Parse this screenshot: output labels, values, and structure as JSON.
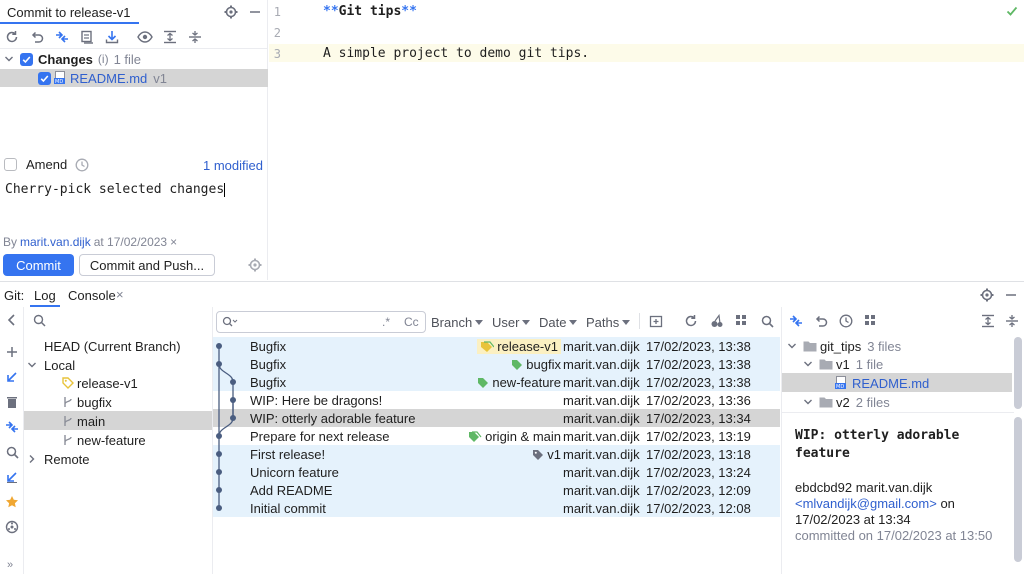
{
  "commit_panel": {
    "tab_title": "Commit to release-v1",
    "changes_label": "Changes",
    "changes_hint": "(i)",
    "changes_count": "1 file",
    "file_name": "README.md",
    "file_version": "v1",
    "amend_label": "Amend",
    "modified_link": "1 modified",
    "message": "Cherry-pick selected changes",
    "author_prefix": "By",
    "author_name": "marit.van.dijk",
    "author_date": "at 17/02/2023",
    "commit_button": "Commit",
    "commit_push_button": "Commit and Push..."
  },
  "editor": {
    "lines": [
      {
        "num": "1",
        "pre": "**",
        "text": "Git tips",
        "post": "**"
      },
      {
        "num": "2",
        "text": ""
      },
      {
        "num": "3",
        "text": "A simple project to demo git tips."
      }
    ]
  },
  "git_panel": {
    "label": "Git:",
    "tabs": [
      {
        "label": "Log"
      },
      {
        "label": "Console"
      }
    ],
    "branches": {
      "head": "HEAD (Current Branch)",
      "local": "Local",
      "local_items": [
        "release-v1",
        "bugfix",
        "main",
        "new-feature"
      ],
      "remote": "Remote"
    },
    "filters": {
      "regex": ".*",
      "case": "Cc",
      "branch": "Branch",
      "user": "User",
      "date": "Date",
      "paths": "Paths"
    },
    "commits": [
      {
        "msg": "Bugfix",
        "tag": "release-v1",
        "author": "marit.van.dijk",
        "date": "17/02/2023, 13:38"
      },
      {
        "msg": "Bugfix",
        "tag": "bugfix",
        "author": "marit.van.dijk",
        "date": "17/02/2023, 13:38"
      },
      {
        "msg": "Bugfix",
        "tag": "new-feature",
        "author": "marit.van.dijk",
        "date": "17/02/2023, 13:38"
      },
      {
        "msg": "WIP: Here be dragons!",
        "tag": "",
        "author": "marit.van.dijk",
        "date": "17/02/2023, 13:36"
      },
      {
        "msg": "WIP: otterly adorable feature",
        "tag": "",
        "author": "marit.van.dijk",
        "date": "17/02/2023, 13:34"
      },
      {
        "msg": "Prepare for next release",
        "tag": "origin & main",
        "author": "marit.van.dijk",
        "date": "17/02/2023, 13:19"
      },
      {
        "msg": "First release!",
        "tag": "v1",
        "author": "marit.van.dijk",
        "date": "17/02/2023, 13:18"
      },
      {
        "msg": "Unicorn feature",
        "tag": "",
        "author": "marit.van.dijk",
        "date": "17/02/2023, 13:24"
      },
      {
        "msg": "Add README",
        "tag": "",
        "author": "marit.van.dijk",
        "date": "17/02/2023, 12:09"
      },
      {
        "msg": "Initial commit",
        "tag": "",
        "author": "marit.van.dijk",
        "date": "17/02/2023, 12:08"
      }
    ],
    "detail": {
      "root": "git_tips",
      "root_count": "3 files",
      "v1": "v1",
      "v1_count": "1 file",
      "file": "README.md",
      "v2": "v2",
      "v2_count": "2 files",
      "title": "WIP: otterly adorable feature",
      "hash_author": "ebdcbd92 marit.van.dijk",
      "email": "<mlvandijk@gmail.com>",
      "on": "on",
      "date": "17/02/2023 at 13:34",
      "committed": "committed on 17/02/2023 at 13:50"
    }
  },
  "colors": {
    "accent": "#3574f0",
    "highlight_row": "#e5f2fc",
    "selected_row": "#d5d5d5",
    "tag_green": "#5fb865",
    "tag_yellow": "#e8c33b",
    "graph_line": "#4a5d80"
  }
}
